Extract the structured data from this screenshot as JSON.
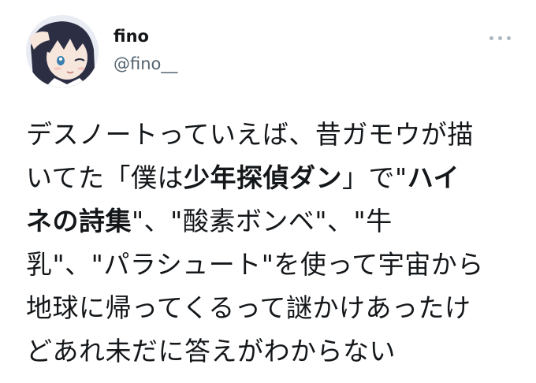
{
  "user": {
    "display_name": "fino",
    "handle": "@fino__"
  },
  "icons": {
    "avatar": "avatar-image",
    "more": "more-horizontal-icon"
  },
  "colors": {
    "text": "#14171a",
    "secondary": "#536471",
    "more_dots": "#aab8c2"
  },
  "tweet": {
    "lines": [
      [
        {
          "text": "デスノートっていえば、昔ガモウが描",
          "bold": false
        }
      ],
      [
        {
          "text": "いてた「僕は",
          "bold": false
        },
        {
          "text": "少年探偵ダン",
          "bold": true
        },
        {
          "text": "」で\"",
          "bold": false
        },
        {
          "text": "ハイ",
          "bold": true
        }
      ],
      [
        {
          "text": "ネの詩集",
          "bold": true
        },
        {
          "text": "\"、\"酸素ボンベ\"、\"牛",
          "bold": false
        }
      ],
      [
        {
          "text": "乳\"、\"パラシュート\"を使って宇宙から",
          "bold": false
        }
      ],
      [
        {
          "text": "地球に帰ってくるって謎かけあったけ",
          "bold": false
        }
      ],
      [
        {
          "text": "どあれ未だに答えがわからない",
          "bold": false
        }
      ]
    ]
  }
}
